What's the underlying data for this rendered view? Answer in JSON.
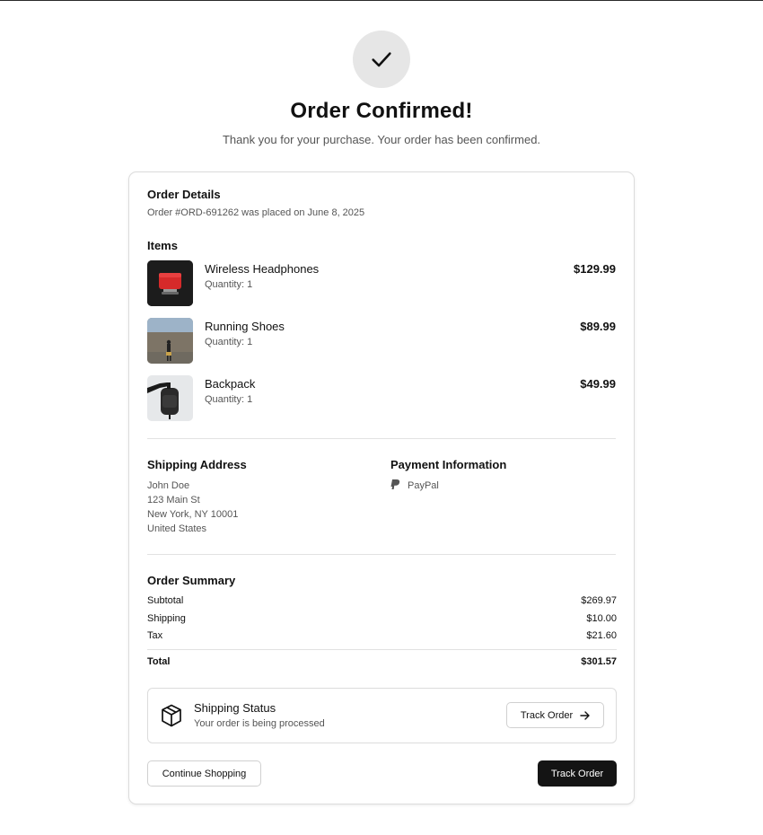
{
  "header": {
    "title": "Order Confirmed!",
    "subtitle": "Thank you for your purchase. Your order has been confirmed."
  },
  "order": {
    "details_heading": "Order Details",
    "placed_text": "Order #ORD-691262 was placed on June 8, 2025",
    "items_heading": "Items",
    "items": [
      {
        "name": "Wireless Headphones",
        "qty": "Quantity: 1",
        "price": "$129.99"
      },
      {
        "name": "Running Shoes",
        "qty": "Quantity: 1",
        "price": "$89.99"
      },
      {
        "name": "Backpack",
        "qty": "Quantity: 1",
        "price": "$49.99"
      }
    ]
  },
  "shipping": {
    "heading": "Shipping Address",
    "lines": [
      "John Doe",
      "123 Main St",
      "New York, NY 10001",
      "United States"
    ]
  },
  "payment": {
    "heading": "Payment Information",
    "method": "PayPal",
    "icon": "paypal-icon"
  },
  "summary": {
    "heading": "Order Summary",
    "rows": [
      {
        "label": "Subtotal",
        "value": "$269.97"
      },
      {
        "label": "Shipping",
        "value": "$10.00"
      },
      {
        "label": "Tax",
        "value": "$21.60"
      }
    ],
    "total": {
      "label": "Total",
      "value": "$301.57"
    }
  },
  "status": {
    "heading": "Shipping Status",
    "text": "Your order is being processed",
    "track_label": "Track Order",
    "icon": "package-icon"
  },
  "actions": {
    "continue_label": "Continue Shopping",
    "track_label": "Track Order"
  },
  "colors": {
    "primary_button": "#141414",
    "check_circle": "#e6e6e6",
    "border": "#dcdcdc"
  }
}
